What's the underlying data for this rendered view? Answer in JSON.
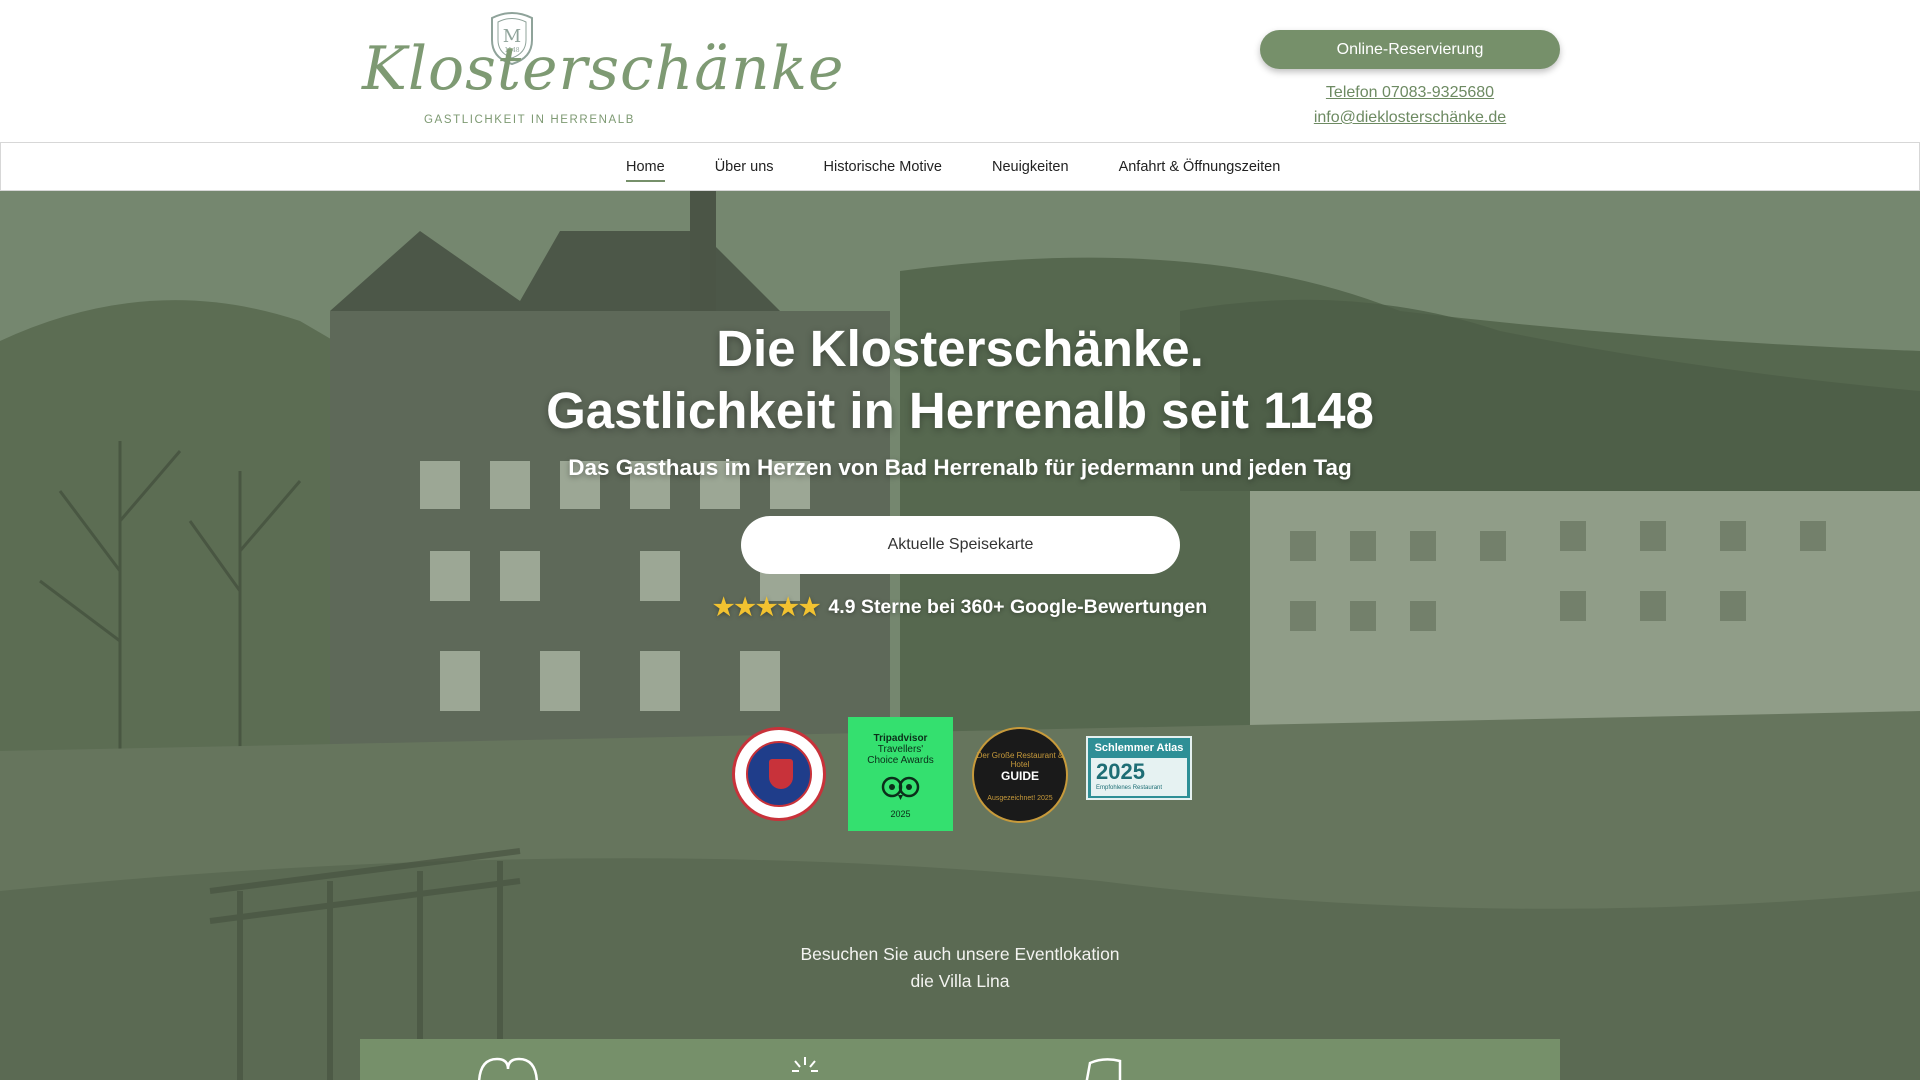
{
  "header": {
    "logo": {
      "crest_letter": "M",
      "script_text": "Klosterschänke",
      "subtitle": "GASTLICHKEIT IN HERRENALB"
    },
    "reserve_button": "Online-Reservierung",
    "phone": "Telefon 07083-9325680",
    "email": "info@dieklosterschänke.de"
  },
  "nav": {
    "items": [
      {
        "label": "Home",
        "active": true
      },
      {
        "label": "Über uns",
        "active": false
      },
      {
        "label": "Historische Motive",
        "active": false
      },
      {
        "label": "Neuigkeiten",
        "active": false
      },
      {
        "label": "Anfahrt & Öffnungszeiten",
        "active": false
      }
    ]
  },
  "hero": {
    "title_line1": "Die Klosterschänke.",
    "title_line2": "Gastlichkeit in Herrenalb seit 1148",
    "subtitle": "Das Gasthaus im Herzen von Bad Herrenalb für jedermann und jeden Tag",
    "menu_button": "Aktuelle Speisekarte",
    "stars": "★★★★★",
    "rating_text": "4.9 Sterne bei 360+ Google-Bewertungen",
    "badges": {
      "chaine": "CHAINE des RÔTISSEURS 1248 - 1950",
      "tripadvisor_line1": "Tripadvisor",
      "tripadvisor_line2": "Travellers'",
      "tripadvisor_line3": "Choice Awards",
      "tripadvisor_year": "2025",
      "guide_top": "Der Große Restaurant & Hotel",
      "guide_main": "GUIDE",
      "guide_bottom": "Ausgezeichnet! 2025",
      "schlemmer_title": "Schlemmer Atlas",
      "schlemmer_year": "2025",
      "schlemmer_sub": "Empfohlenes Restaurant"
    },
    "villa_line1": "Besuchen Sie auch unsere Eventlokation",
    "villa_line2": "die Villa Lina"
  },
  "colors": {
    "brand_green": "#76906a",
    "logo_green": "#7e9a73",
    "star_gold": "#f2c230",
    "tripadvisor_green": "#34e06f"
  },
  "icons": [
    "crest-icon",
    "star-icon",
    "heart-icon",
    "sun-icon",
    "book-icon"
  ]
}
